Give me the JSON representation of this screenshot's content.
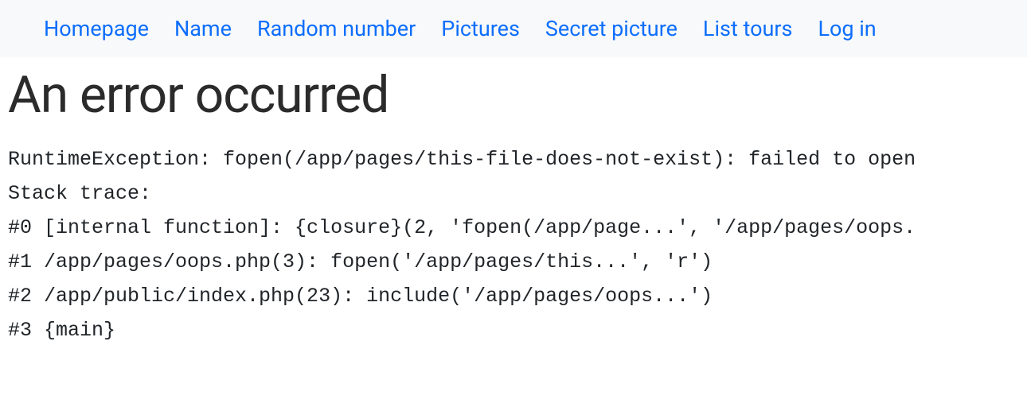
{
  "nav": {
    "items": [
      {
        "label": "Homepage"
      },
      {
        "label": "Name"
      },
      {
        "label": "Random number"
      },
      {
        "label": "Pictures"
      },
      {
        "label": "Secret picture"
      },
      {
        "label": "List tours"
      },
      {
        "label": "Log in"
      }
    ]
  },
  "error": {
    "title": "An error occurred",
    "lines": [
      "RuntimeException: fopen(/app/pages/this-file-does-not-exist): failed to open ",
      "Stack trace:",
      "#0 [internal function]: {closure}(2, 'fopen(/app/page...', '/app/pages/oops.",
      "#1 /app/pages/oops.php(3): fopen('/app/pages/this...', 'r')",
      "#2 /app/public/index.php(23): include('/app/pages/oops...')",
      "#3 {main}"
    ]
  }
}
